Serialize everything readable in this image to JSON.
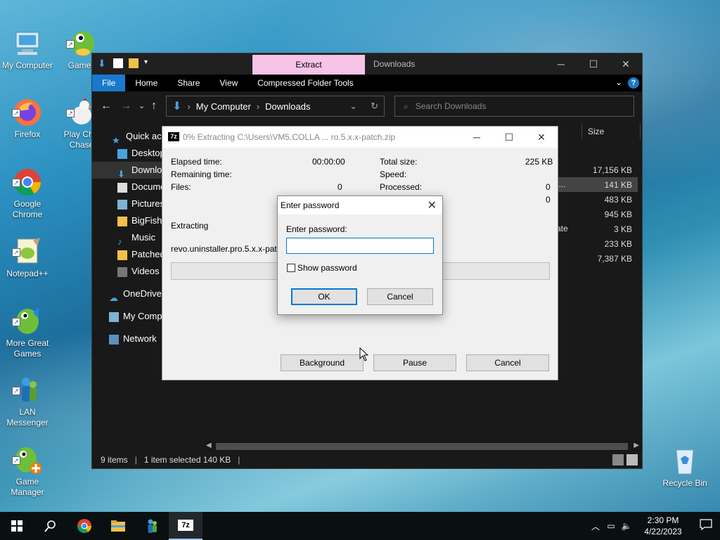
{
  "desktop": {
    "icons": [
      {
        "label": "My Computer"
      },
      {
        "label": "Games"
      },
      {
        "label": "Firefox"
      },
      {
        "label": "Play Chic\nChase"
      },
      {
        "label": "Google\nChrome"
      },
      {
        "label": "Notepad++"
      },
      {
        "label": "More Great\nGames"
      },
      {
        "label": "LAN\nMessenger"
      },
      {
        "label": "Game\nManager"
      },
      {
        "label": "Recycle Bin"
      }
    ]
  },
  "explorer": {
    "context_tab": "Extract",
    "title": "Downloads",
    "ribbon_tabs": [
      "File",
      "Home",
      "Share",
      "View",
      "Compressed Folder Tools"
    ],
    "help": "?",
    "breadcrumb": [
      "My Computer",
      "Downloads"
    ],
    "search_placeholder": "Search Downloads",
    "nav": [
      "Quick access",
      "Desktop",
      "Downloads",
      "Documents",
      "Pictures",
      "BigFishGames",
      "Music",
      "Patched",
      "Videos",
      "OneDrive",
      "My Computer",
      "Network"
    ],
    "column_size": "Size",
    "sizes": [
      "17,156 KB",
      "141 KB",
      "483 KB",
      "945 KB",
      "3 KB",
      "233 KB",
      "7,387 KB"
    ],
    "frag1": "pp...",
    "frag2": "ate",
    "status_items": "9 items",
    "status_selected": "1 item selected  140 KB"
  },
  "zip": {
    "title": "0% Extracting C:\\Users\\VM5.COLLA ... ro.5.x.x-patch.zip",
    "icon_text": "7z",
    "elapsed_label": "Elapsed time:",
    "elapsed_value": "00:00:00",
    "remaining_label": "Remaining time:",
    "files_label": "Files:",
    "files_value": "0",
    "total_label": "Total size:",
    "total_value": "225 KB",
    "speed_label": "Speed:",
    "processed_label": "Processed:",
    "processed_value": "0",
    "fourth_value": "0",
    "extracting_label": "Extracting",
    "file_name": "revo.uninstaller.pro.5.x.x-patch.e",
    "progress": 0,
    "buttons": {
      "background": "Background",
      "pause": "Pause",
      "cancel": "Cancel"
    }
  },
  "password_dialog": {
    "title": "Enter password",
    "label": "Enter password:",
    "value": "",
    "show_password": "Show password",
    "ok": "OK",
    "cancel": "Cancel"
  },
  "taskbar": {
    "time": "2:30 PM",
    "date": "4/22/2023",
    "zip_label": "7z"
  }
}
